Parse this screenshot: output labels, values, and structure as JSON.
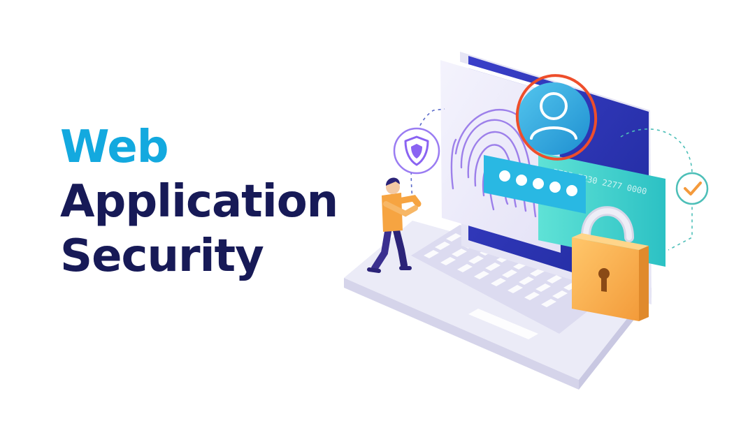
{
  "headline": {
    "line1": "Web",
    "line2": "Application",
    "line3": "Security"
  },
  "illustration": {
    "card_number": "5725 7230 2277 0000",
    "password_dots": 5
  },
  "colors": {
    "accent": "#13a9df",
    "navy": "#171a57",
    "screen_blue": "#2b36b8",
    "card_teal": "#3fd0cf",
    "lock_orange": "#f7a84a",
    "ring_red": "#ee4e2b",
    "shield_purple": "#8a63f2",
    "check_orange": "#f49a3c"
  },
  "icons": [
    "fingerprint-icon",
    "user-avatar-icon",
    "shield-icon",
    "checkmark-icon",
    "padlock-icon"
  ]
}
